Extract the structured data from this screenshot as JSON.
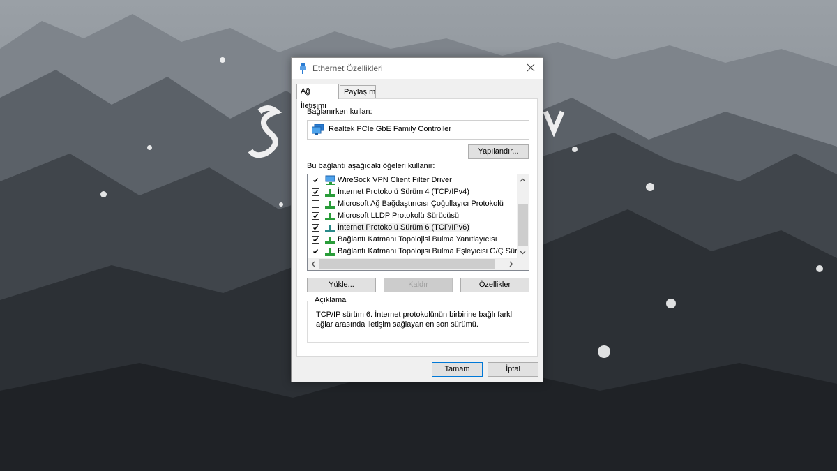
{
  "window": {
    "title": "Ethernet Özellikleri"
  },
  "tabs": [
    {
      "label": "Ağ İletişimi",
      "active": true
    },
    {
      "label": "Paylaşım",
      "active": false
    }
  ],
  "connect_using": {
    "label": "Bağlanırken kullan:",
    "adapter": "Realtek PCIe GbE Family Controller",
    "configure_button": "Yapılandır..."
  },
  "items_label": "Bu bağlantı aşağıdaki öğeleri kullanır:",
  "items": [
    {
      "label": "WireSock VPN Client Filter Driver",
      "checked": true,
      "icon": "network-service-icon"
    },
    {
      "label": "İnternet Protokolü Sürüm 4 (TCP/IPv4)",
      "checked": true,
      "icon": "protocol-icon"
    },
    {
      "label": "Microsoft Ağ Bağdaştırıcısı Çoğullayıcı Protokolü",
      "checked": false,
      "icon": "protocol-icon"
    },
    {
      "label": "Microsoft LLDP Protokolü Sürücüsü",
      "checked": true,
      "icon": "protocol-icon"
    },
    {
      "label": "İnternet Protokolü Sürüm 6 (TCP/IPv6)",
      "checked": true,
      "icon": "protocol-icon",
      "selected": true
    },
    {
      "label": "Bağlantı Katmanı Topolojisi Bulma Yanıtlayıcısı",
      "checked": true,
      "icon": "protocol-icon"
    },
    {
      "label": "Bağlantı Katmanı Topolojisi Bulma Eşleyicisi G/Ç Sürücü",
      "checked": true,
      "icon": "protocol-icon"
    }
  ],
  "buttons": {
    "install": "Yükle...",
    "uninstall": "Kaldır",
    "properties": "Özellikler",
    "ok": "Tamam",
    "cancel": "İptal"
  },
  "description": {
    "title": "Açıklama",
    "text": "TCP/IP sürüm 6. İnternet protokolünün birbirine bağlı farklı ağlar arasında iletişim sağlayan en son sürümü."
  },
  "colors": {
    "accent": "#0078d7",
    "protocol_icon": "#2a9d3a",
    "adapter_icon": "#2b7cd3"
  }
}
